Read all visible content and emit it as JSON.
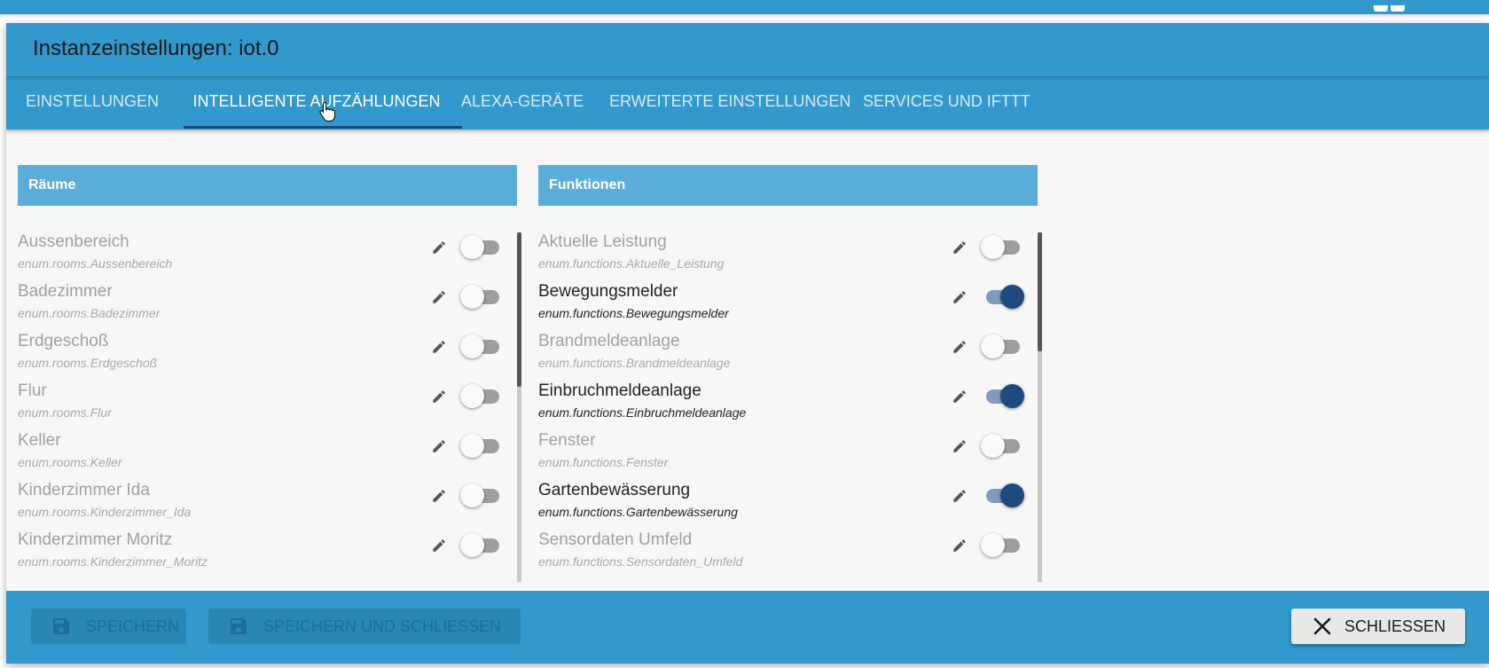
{
  "dialog": {
    "title": "Instanzeinstellungen: iot.0"
  },
  "tabs": [
    {
      "label": "EINSTELLUNGEN",
      "active": false
    },
    {
      "label": "INTELLIGENTE AUFZÄHLUNGEN",
      "active": true
    },
    {
      "label": "ALEXA-GERÄTE",
      "active": false
    },
    {
      "label": "ERWEITERTE EINSTELLUNGEN",
      "active": false
    },
    {
      "label": "SERVICES UND IFTTT",
      "active": false
    }
  ],
  "rooms": {
    "header": "Räume",
    "items": [
      {
        "name": "Aussenbereich",
        "id": "enum.rooms.Aussenbereich",
        "enabled": false
      },
      {
        "name": "Badezimmer",
        "id": "enum.rooms.Badezimmer",
        "enabled": false
      },
      {
        "name": "Erdgeschoß",
        "id": "enum.rooms.Erdgeschoß",
        "enabled": false
      },
      {
        "name": "Flur",
        "id": "enum.rooms.Flur",
        "enabled": false
      },
      {
        "name": "Keller",
        "id": "enum.rooms.Keller",
        "enabled": false
      },
      {
        "name": "Kinderzimmer Ida",
        "id": "enum.rooms.Kinderzimmer_Ida",
        "enabled": false
      },
      {
        "name": "Kinderzimmer Moritz",
        "id": "enum.rooms.Kinderzimmer_Moritz",
        "enabled": false
      }
    ]
  },
  "functions": {
    "header": "Funktionen",
    "items": [
      {
        "name": "Aktuelle Leistung",
        "id": "enum.functions.Aktuelle_Leistung",
        "enabled": false
      },
      {
        "name": "Bewegungsmelder",
        "id": "enum.functions.Bewegungsmelder",
        "enabled": true
      },
      {
        "name": "Brandmeldeanlage",
        "id": "enum.functions.Brandmeldeanlage",
        "enabled": false
      },
      {
        "name": "Einbruchmeldeanlage",
        "id": "enum.functions.Einbruchmeldeanlage",
        "enabled": true
      },
      {
        "name": "Fenster",
        "id": "enum.functions.Fenster",
        "enabled": false
      },
      {
        "name": "Gartenbewässerung",
        "id": "enum.functions.Gartenbewässerung",
        "enabled": true
      },
      {
        "name": "Sensordaten Umfeld",
        "id": "enum.functions.Sensordaten_Umfeld",
        "enabled": false
      }
    ]
  },
  "footer": {
    "save_label": "SPEICHERN",
    "save_close_label": "SPEICHERN UND SCHLIESSEN",
    "close_label": "SCHLIESSEN"
  },
  "icons": {
    "edit": "pencil-icon",
    "save": "floppy-disk-icon",
    "close": "close-x-icon"
  },
  "colors": {
    "primary": "#3399cc",
    "panel_header": "#5aaed9",
    "toggle_on": "#1f4a7e",
    "toggle_off": "#9e9e9e"
  }
}
